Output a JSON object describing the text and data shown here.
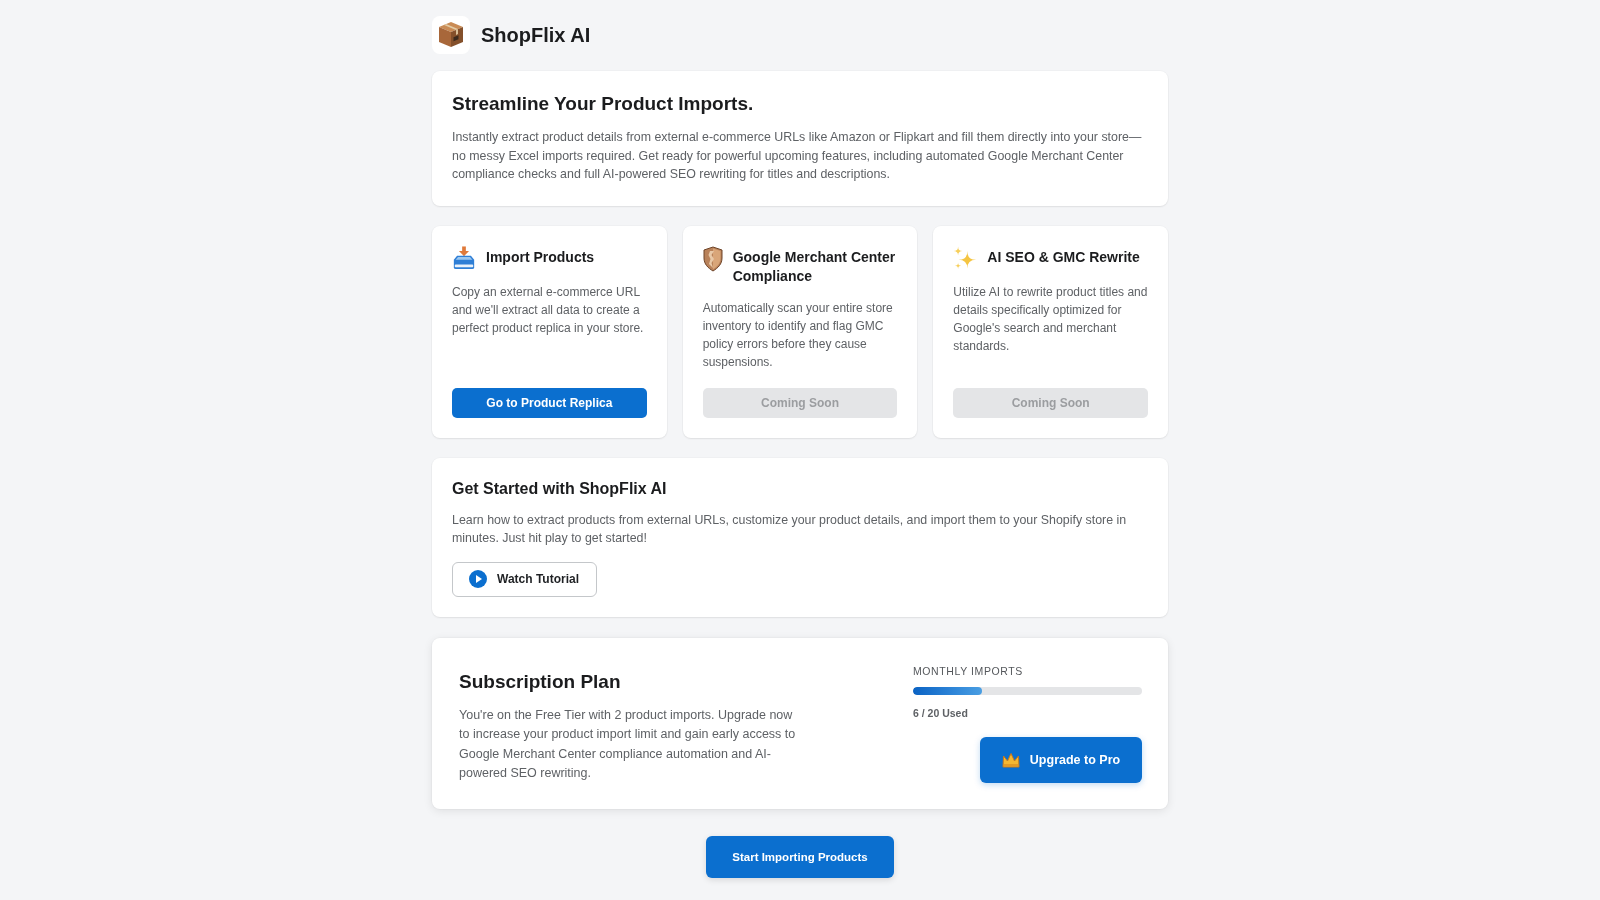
{
  "header": {
    "title": "ShopFlix AI"
  },
  "intro": {
    "title": "Streamline Your Product Imports.",
    "text": "Instantly extract product details from external e-commerce URLs like Amazon or Flipkart and fill them directly into your store—no messy Excel imports required. Get ready for powerful upcoming features, including automated Google Merchant Center compliance checks and full AI-powered SEO rewriting for titles and descriptions."
  },
  "features": [
    {
      "kind": "import",
      "title": "Import Products",
      "text": "Copy an external e-commerce URL and we'll extract all data to create a perfect product replica in your store.",
      "button": {
        "label": "Go to Product Replica",
        "disabled": false
      }
    },
    {
      "kind": "compliance",
      "title": "Google Merchant Center Compliance",
      "text": "Automatically scan your entire store inventory to identify and flag GMC policy errors before they cause suspensions.",
      "button": {
        "label": "Coming Soon",
        "disabled": true
      }
    },
    {
      "kind": "seo",
      "title": "AI SEO & GMC Rewrite",
      "text": "Utilize AI to rewrite product titles and details specifically optimized for Google's search and merchant standards.",
      "button": {
        "label": "Coming Soon",
        "disabled": true
      }
    }
  ],
  "tutorial": {
    "title": "Get Started with ShopFlix AI",
    "text": "Learn how to extract products from external URLs, customize your product details, and import them to your Shopify store in minutes. Just hit play to get started!",
    "button": "Watch Tutorial"
  },
  "subscription": {
    "title": "Subscription Plan",
    "text": "You're on the Free Tier with 2 product imports. Upgrade now to increase your product import limit and gain early access to Google Merchant Center compliance automation and AI-powered SEO rewriting.",
    "meter": {
      "label": "MONTHLY IMPORTS",
      "level": 0.3,
      "reading": "6 / 20 Used"
    },
    "button": "Upgrade to Pro"
  },
  "footer_button": "Start Importing Products"
}
